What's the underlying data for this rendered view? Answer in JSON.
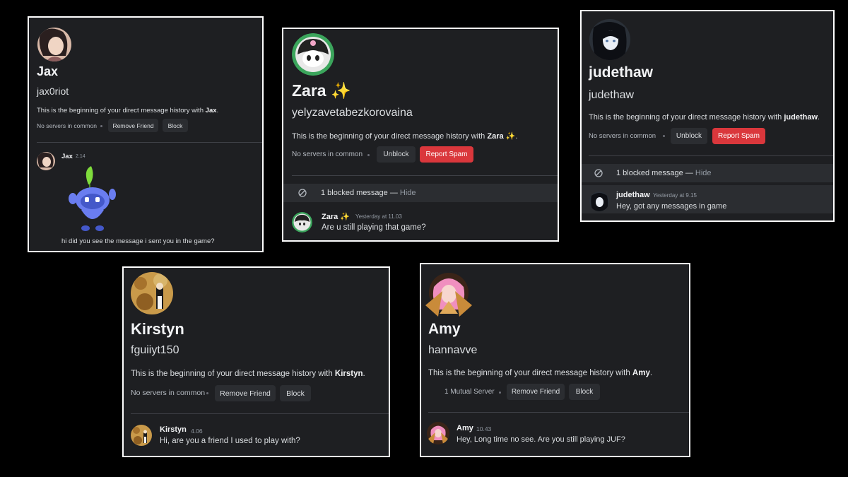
{
  "colors": {
    "background": "#000000",
    "panel": "#1e1f22",
    "button": "#2b2d31",
    "danger": "#da373c",
    "frame": "#ffffff"
  },
  "panels": {
    "jax": {
      "display_name": "Jax",
      "username": "jax0riot",
      "intro_prefix": "This is the beginning of your direct message history with ",
      "intro_name": "Jax",
      "intro_suffix": ".",
      "servers": "No servers in common",
      "buttons": [
        "Remove Friend",
        "Block"
      ],
      "message": {
        "author": "Jax",
        "time": "2.14",
        "sticker": "wumpus-sticker",
        "text": "hi did you see the message i sent you in the game?"
      }
    },
    "zara": {
      "display_name": "Zara ✨",
      "username": "yelyzavetabezkorovaina",
      "intro_prefix": "This is the beginning of your direct message history with ",
      "intro_name": "Zara ✨",
      "intro_suffix": ".",
      "servers": "No servers in common",
      "buttons": [
        "Unblock",
        "Report Spam"
      ],
      "blocked": {
        "text": "1 blocked message — ",
        "hide": "Hide"
      },
      "message": {
        "author": "Zara ✨",
        "time": "Yesterday at 11.03",
        "text": "Are u still playing that game?"
      }
    },
    "judethaw": {
      "display_name": "judethaw",
      "username": "judethaw",
      "intro_prefix": "This is the beginning of your direct message history with ",
      "intro_name": "judethaw",
      "intro_suffix": ".",
      "servers": "No servers in common",
      "buttons": [
        "Unblock",
        "Report Spam"
      ],
      "blocked": {
        "text": "1 blocked message — ",
        "hide": "Hide"
      },
      "message": {
        "author": "judethaw",
        "time": "Yesterday at 9.15",
        "text": "Hey, got any messages in game"
      }
    },
    "kirstyn": {
      "display_name": "Kirstyn",
      "username": "fguiiyt150",
      "intro_prefix": "This is the beginning of your direct message history with ",
      "intro_name": "Kirstyn",
      "intro_suffix": ".",
      "servers": "No servers in common",
      "buttons": [
        "Remove Friend",
        "Block"
      ],
      "message": {
        "author": "Kirstyn",
        "time": "4.06",
        "text": "Hi, are you a friend I used to play with?"
      }
    },
    "amy": {
      "display_name": "Amy",
      "username": "hannavve",
      "intro_prefix": "This is the beginning of your direct message history with ",
      "intro_name": "Amy",
      "intro_suffix": ".",
      "servers": "1 Mutual Server",
      "buttons": [
        "Remove Friend",
        "Block"
      ],
      "message": {
        "author": "Amy",
        "time": "10.43",
        "text": "Hey, Long time no see. Are you still playing JUF?"
      }
    }
  }
}
